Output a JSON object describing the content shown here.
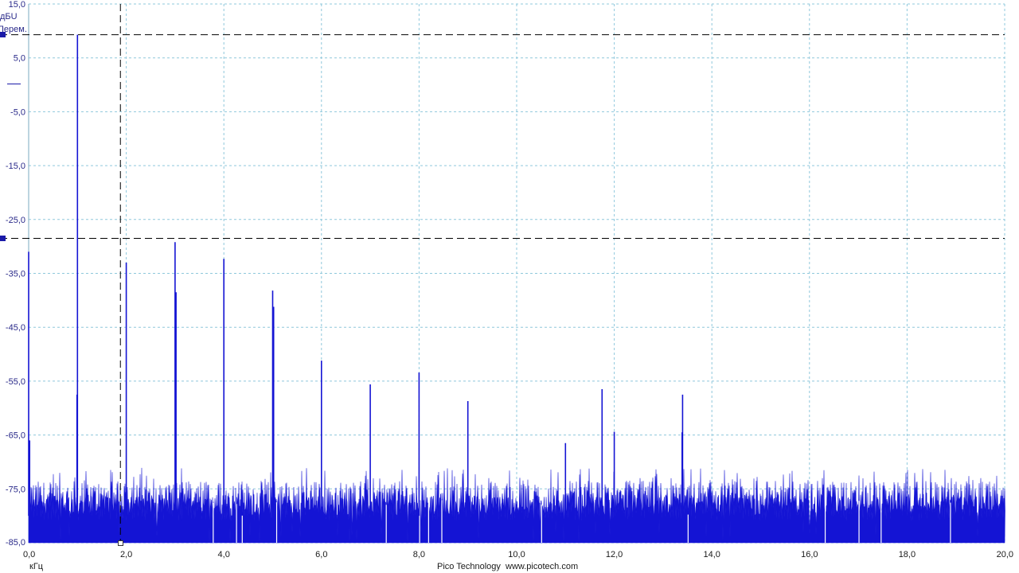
{
  "window": {
    "unit_y": "дБU",
    "mode_y": "Перем.",
    "unit_x": "кГц",
    "footer": "Pico Technology  www.picotech.com"
  },
  "colors": {
    "trace": "#1414d4",
    "grid": "#8fc8dc",
    "ruler": "#000000",
    "axis_label": "#2a2a8a"
  },
  "chart_data": {
    "type": "line",
    "title": "",
    "xlabel": "кГц",
    "ylabel": "дБU",
    "xlim": [
      0,
      20
    ],
    "ylim": [
      -85,
      15
    ],
    "x_ticks": [
      "0,0",
      "2,0",
      "4,0",
      "6,0",
      "8,0",
      "10,0",
      "12,0",
      "14,0",
      "16,0",
      "18,0",
      "20,0"
    ],
    "y_ticks": [
      "15,0",
      "5,0",
      "-5,0",
      "-15,0",
      "-25,0",
      "-35,0",
      "-45,0",
      "-55,0",
      "-65,0",
      "-75,0",
      "-85,0"
    ],
    "grid": true,
    "noise_floor_range": [
      -85,
      -72
    ],
    "series": [
      {
        "peaks": [
          {
            "x": 0.0,
            "y": -31
          },
          {
            "x": 0.02,
            "y": -66
          },
          {
            "x": 1.0,
            "y": 9.3
          },
          {
            "x": 0.99,
            "y": -57.5
          },
          {
            "x": 2.0,
            "y": -33
          },
          {
            "x": 3.0,
            "y": -29.2
          },
          {
            "x": 3.02,
            "y": -38.5
          },
          {
            "x": 4.0,
            "y": -32.3
          },
          {
            "x": 5.0,
            "y": -38.2
          },
          {
            "x": 5.02,
            "y": -41.2
          },
          {
            "x": 6.0,
            "y": -51.2
          },
          {
            "x": 7.0,
            "y": -55.6
          },
          {
            "x": 8.0,
            "y": -53.4
          },
          {
            "x": 9.0,
            "y": -58.7
          },
          {
            "x": 11.0,
            "y": -66.5
          },
          {
            "x": 11.75,
            "y": -56.5
          },
          {
            "x": 12.0,
            "y": -64.4
          },
          {
            "x": 13.4,
            "y": -57.5
          },
          {
            "x": 13.39,
            "y": -64.5
          }
        ]
      }
    ],
    "rulers": {
      "horizontal": [
        9.3,
        -28.5
      ],
      "vertical": [
        1.88
      ]
    }
  }
}
